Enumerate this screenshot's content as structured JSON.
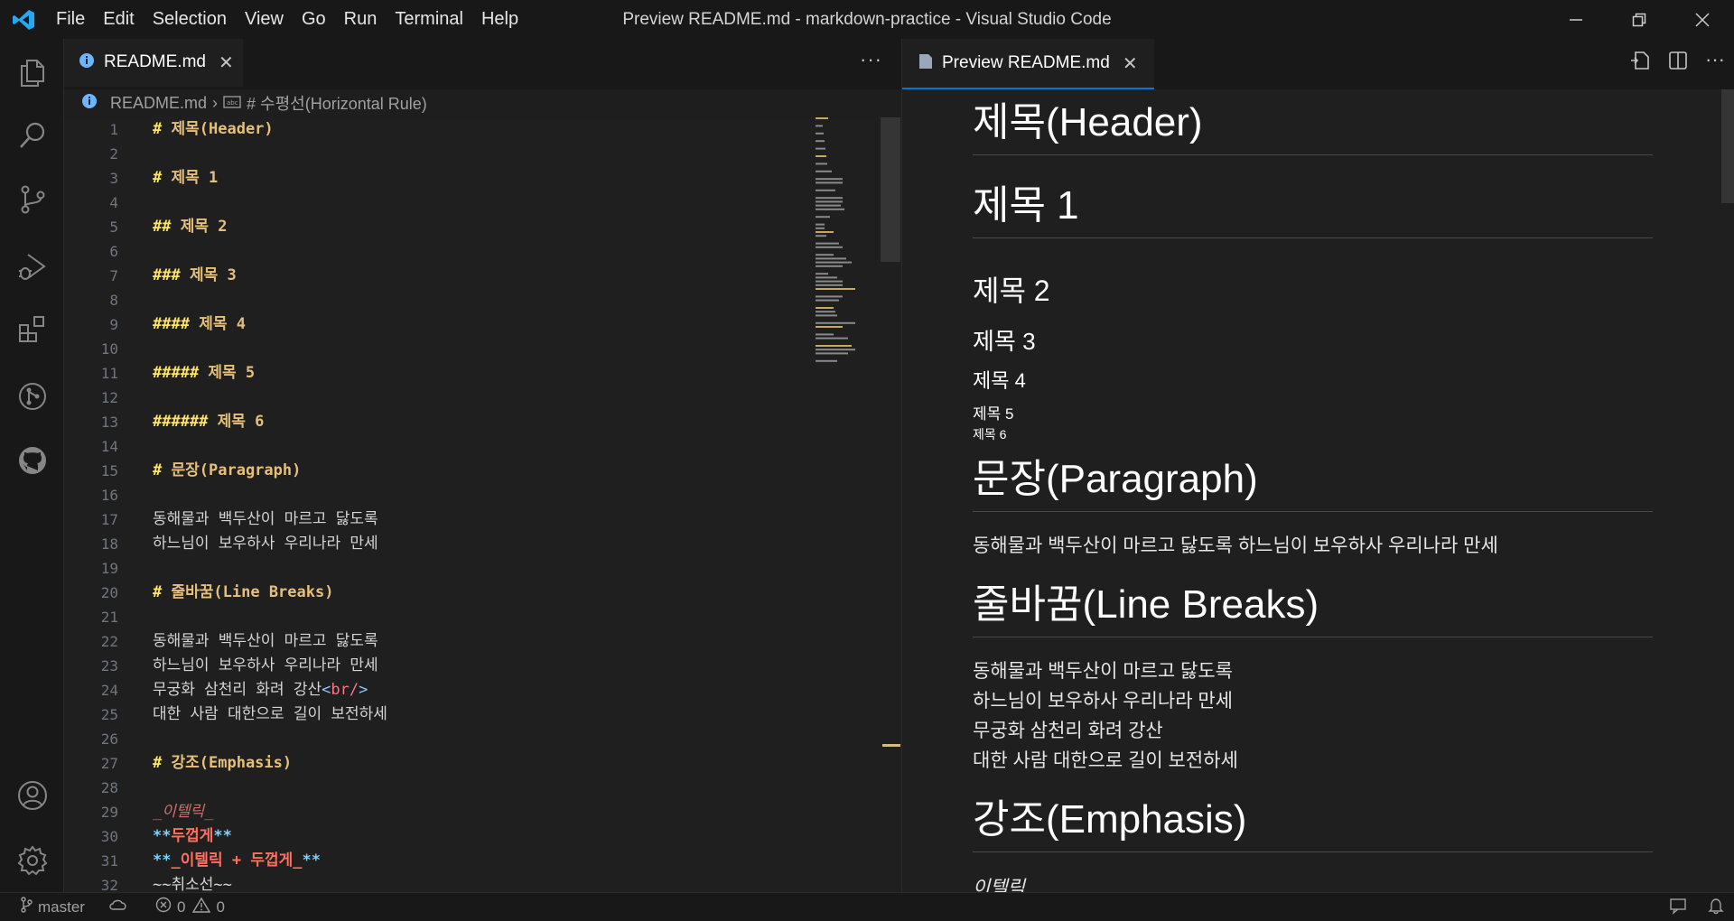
{
  "titlebar": {
    "menu": [
      "File",
      "Edit",
      "Selection",
      "View",
      "Go",
      "Run",
      "Terminal",
      "Help"
    ],
    "title": "Preview README.md - markdown-practice - Visual Studio Code"
  },
  "activitybar": {
    "icons": [
      "explorer-icon",
      "search-icon",
      "source-control-icon",
      "run-debug-icon",
      "extensions-icon",
      "git-graph-icon",
      "github-icon",
      "account-icon",
      "settings-gear-icon"
    ]
  },
  "editor": {
    "tab_label": "README.md",
    "breadcrumb": {
      "file": "README.md",
      "symbol": "# 수평선(Horizontal Rule)"
    },
    "lines": [
      {
        "n": "1",
        "hash": "# ",
        "text": "제목(Header)"
      },
      {
        "n": "2"
      },
      {
        "n": "3",
        "hash": "# ",
        "text": "제목 1"
      },
      {
        "n": "4"
      },
      {
        "n": "5",
        "hash": "## ",
        "text": "제목 2"
      },
      {
        "n": "6"
      },
      {
        "n": "7",
        "hash": "### ",
        "text": "제목 3"
      },
      {
        "n": "8"
      },
      {
        "n": "9",
        "hash": "#### ",
        "text": "제목 4"
      },
      {
        "n": "10"
      },
      {
        "n": "11",
        "hash": "##### ",
        "text": "제목 5"
      },
      {
        "n": "12"
      },
      {
        "n": "13",
        "hash": "###### ",
        "text": "제목 6"
      },
      {
        "n": "14"
      },
      {
        "n": "15",
        "hash": "# ",
        "text": "문장(Paragraph)"
      },
      {
        "n": "16"
      },
      {
        "n": "17",
        "plain": "동해물과 백두산이 마르고 닳도록"
      },
      {
        "n": "18",
        "plain": "하느님이 보우하사 우리나라 만세"
      },
      {
        "n": "19"
      },
      {
        "n": "20",
        "hash": "# ",
        "text": "줄바꿈(Line Breaks)"
      },
      {
        "n": "21"
      },
      {
        "n": "22",
        "plain": "동해물과 백두산이 마르고 닳도록"
      },
      {
        "n": "23",
        "plain": "하느님이 보우하사 우리나라 만세"
      },
      {
        "n": "24",
        "plain": "무궁화 삼천리 화려 강산",
        "tag": "br/"
      },
      {
        "n": "25",
        "plain": "대한 사람 대한으로 길이 보전하세"
      },
      {
        "n": "26"
      },
      {
        "n": "27",
        "hash": "# ",
        "text": "강조(Emphasis)"
      },
      {
        "n": "28"
      },
      {
        "n": "29",
        "em": "_이텔릭_"
      },
      {
        "n": "30",
        "strong": "두껍게"
      },
      {
        "n": "31",
        "strong_em": "_이텔릭 + 두껍게_"
      },
      {
        "n": "32",
        "plain": "~~취소선~~"
      }
    ]
  },
  "preview": {
    "tab_label": "Preview README.md",
    "h1_header": "제목(Header)",
    "h1_title1": "제목 1",
    "h2": "제목 2",
    "h3": "제목 3",
    "h4": "제목 4",
    "h5": "제목 5",
    "h6": "제목 6",
    "h1_paragraph": "문장(Paragraph)",
    "paragraph": "동해물과 백두산이 마르고 닳도록 하느님이 보우하사 우리나라 만세",
    "h1_linebreaks": "줄바꿈(Line Breaks)",
    "lb1": "동해물과 백두산이 마르고 닳도록",
    "lb2": "하느님이 보우하사 우리나라 만세",
    "lb3": "무궁화 삼천리 화려 강산",
    "lb4": "대한 사람 대한으로 길이 보전하세",
    "h1_emphasis": "강조(Emphasis)",
    "italic": "이텔릭"
  },
  "statusbar": {
    "branch": "master",
    "errors": "0",
    "warnings": "0"
  },
  "colors": {
    "accent": "#0078d4",
    "vscode_blue": "#23a9f2"
  }
}
